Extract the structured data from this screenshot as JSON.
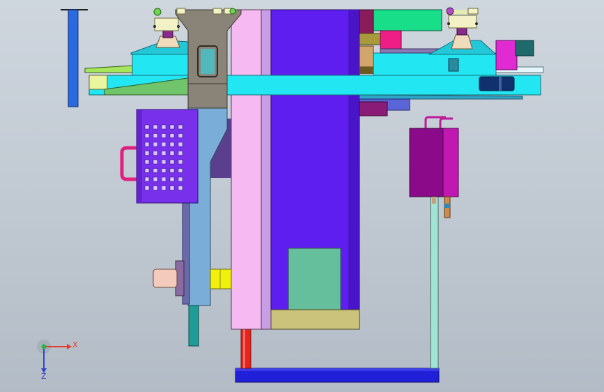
{
  "viewport": {
    "background_top": "#cfd6de",
    "background_bottom": "#b3bcc6"
  },
  "triad": {
    "x_label": "X",
    "z_label": "Z",
    "x_color": "#e53b2c",
    "y_color": "#2bb34a",
    "z_color": "#3147c6"
  }
}
